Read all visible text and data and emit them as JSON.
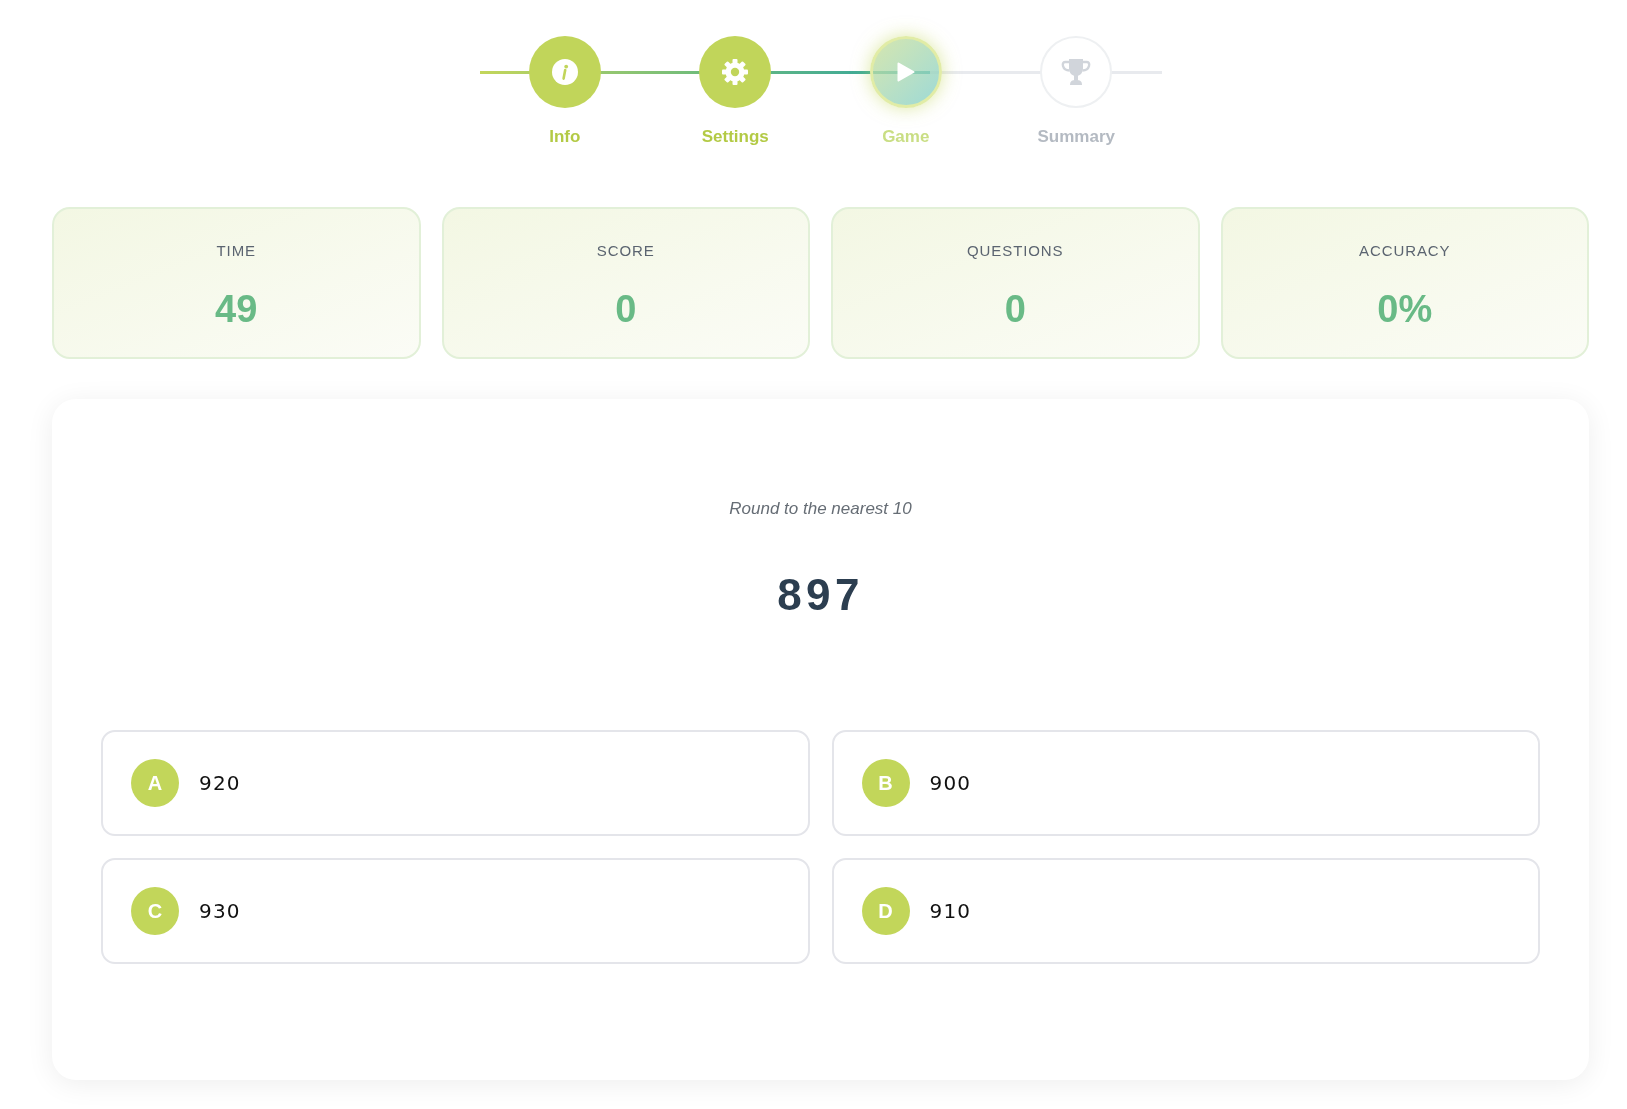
{
  "stepper": {
    "level": 0.66,
    "steps": [
      {
        "label": "Info",
        "completed": true,
        "current": false
      },
      {
        "label": "Settings",
        "completed": true,
        "current": false
      },
      {
        "label": "Game",
        "completed": false,
        "current": true
      },
      {
        "label": "Summary",
        "completed": false,
        "current": false
      }
    ]
  },
  "stats": [
    {
      "label": "TIME",
      "value": "49"
    },
    {
      "label": "SCORE",
      "value": "0"
    },
    {
      "label": "QUESTIONS",
      "value": "0"
    },
    {
      "label": "ACCURACY",
      "value": "0%"
    }
  ],
  "question": {
    "prompt": "Round to the nearest 10",
    "number": "897"
  },
  "answers": [
    {
      "letter": "A",
      "value": "920"
    },
    {
      "letter": "B",
      "value": "900"
    },
    {
      "letter": "C",
      "value": "930"
    },
    {
      "letter": "D",
      "value": "910"
    }
  ]
}
